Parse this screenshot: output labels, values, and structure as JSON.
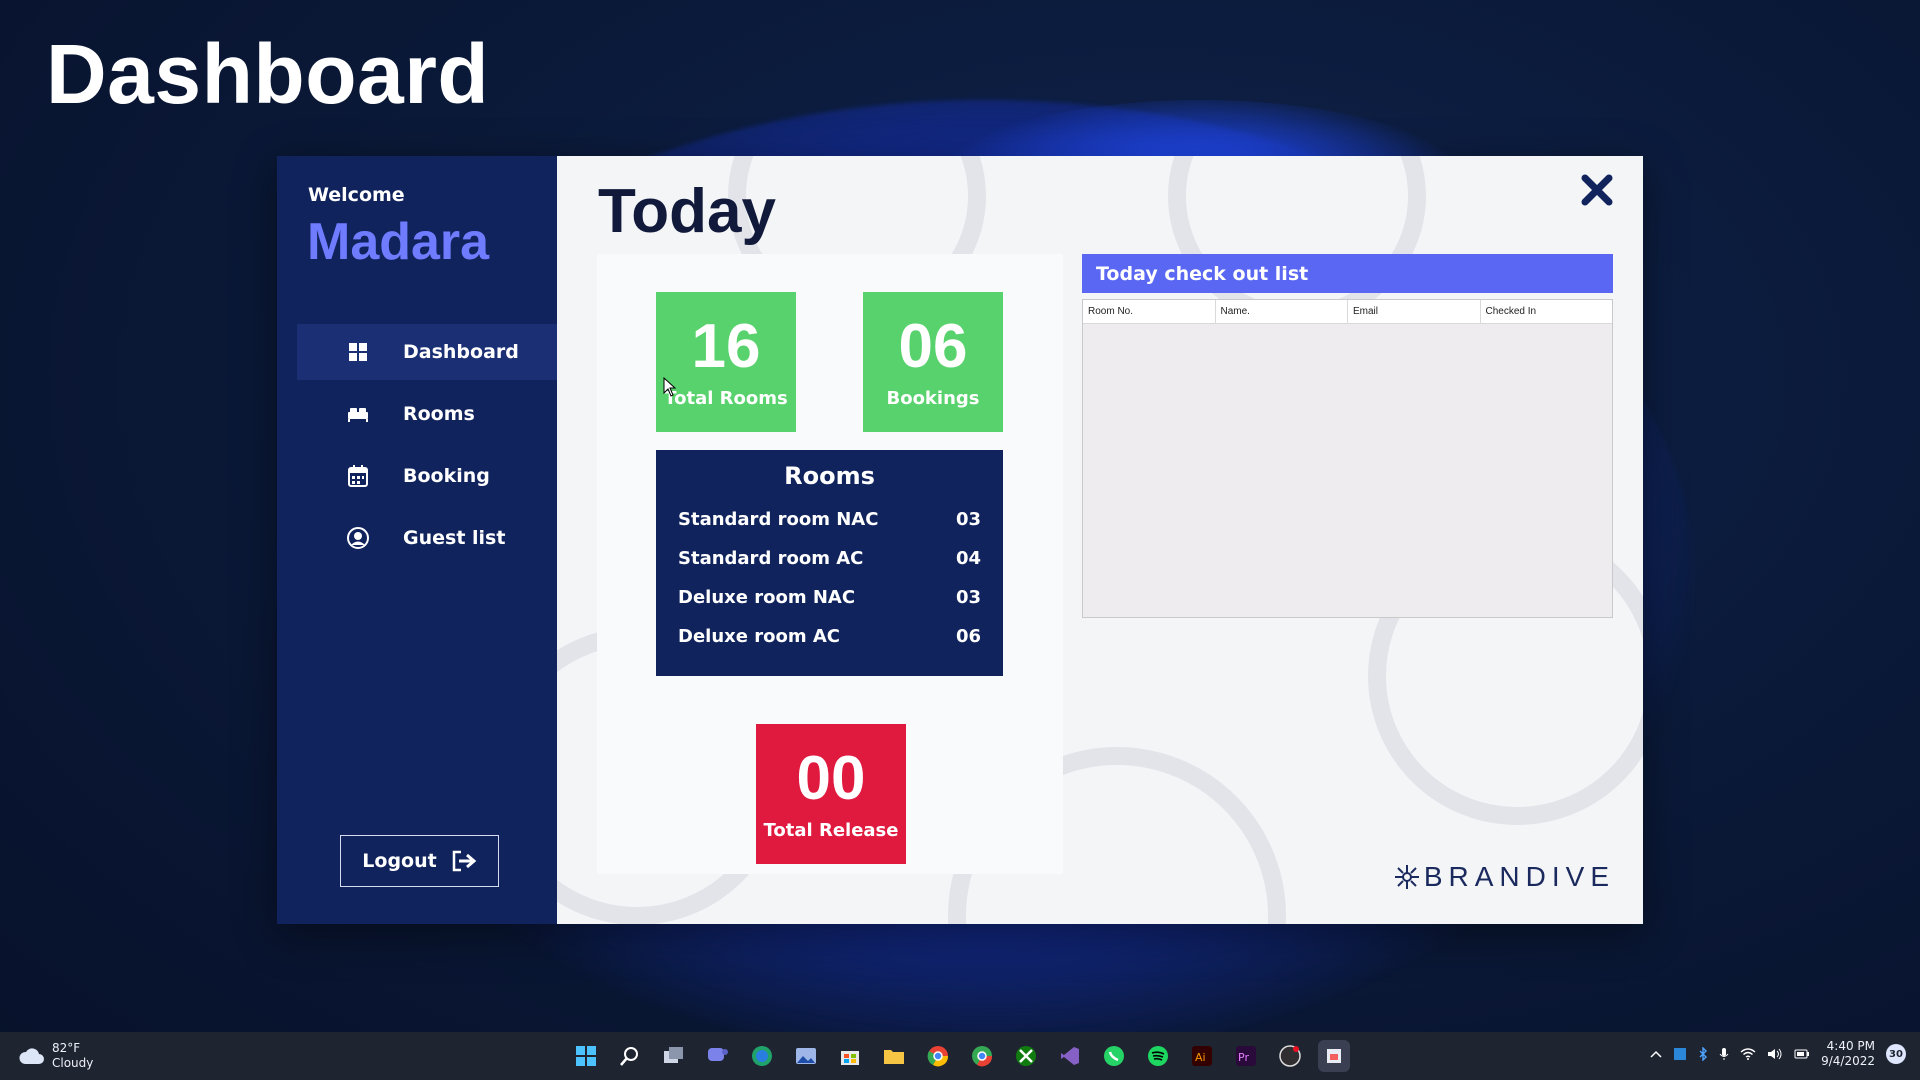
{
  "overlay": {
    "title": "Dashboard"
  },
  "sidebar": {
    "welcome": "Welcome",
    "username": "Madara",
    "items": [
      {
        "label": "Dashboard",
        "icon": "grid-icon",
        "active": true
      },
      {
        "label": "Rooms",
        "icon": "bed-icon",
        "active": false
      },
      {
        "label": "Booking",
        "icon": "calendar-icon",
        "active": false
      },
      {
        "label": "Guest list",
        "icon": "user-icon",
        "active": false
      }
    ],
    "logout_label": "Logout"
  },
  "main": {
    "title": "Today",
    "stats": {
      "total_rooms": {
        "value": "16",
        "label": "Total Rooms"
      },
      "bookings": {
        "value": "06",
        "label": "Bookings"
      },
      "total_release": {
        "value": "00",
        "label": "Total Release"
      }
    },
    "rooms": {
      "title": "Rooms",
      "rows": [
        {
          "name": "Standard room NAC",
          "count": "03"
        },
        {
          "name": "Standard room AC",
          "count": "04"
        },
        {
          "name": "Deluxe room NAC",
          "count": "03"
        },
        {
          "name": "Deluxe room AC",
          "count": "06"
        }
      ]
    },
    "checkout": {
      "title": "Today check out list",
      "columns": [
        "Room No.",
        "Name.",
        "Email",
        "Checked In"
      ],
      "rows": []
    },
    "brand": "BRANDIVE"
  },
  "taskbar": {
    "weather": {
      "temp": "82°F",
      "condition": "Cloudy"
    },
    "clock": {
      "time": "4:40 PM",
      "date": "9/4/2022"
    },
    "notifications": "30"
  },
  "colors": {
    "sidebar_bg": "#10235d",
    "accent_purple": "#6f7cff",
    "stat_green": "#58d26c",
    "stat_red": "#e0193f",
    "checkout_header": "#5a67f2"
  }
}
